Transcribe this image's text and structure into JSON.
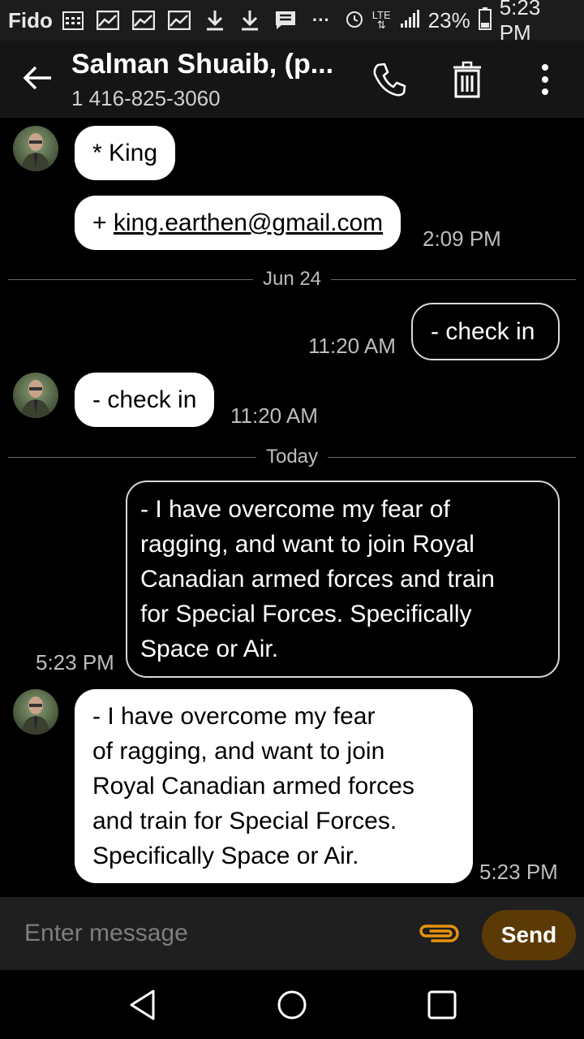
{
  "status_bar": {
    "carrier": "Fido",
    "network": "LTE",
    "battery": "23%",
    "time": "5:23 PM",
    "icons": [
      "calendar-icon",
      "gallery-icon",
      "gallery-icon",
      "gallery-icon",
      "download-icon",
      "download-icon",
      "message-icon",
      "more-icon",
      "alarm-icon",
      "network-icon",
      "signal-icon",
      "battery-icon"
    ]
  },
  "header": {
    "contact_name": "Salman Shuaib, (p...",
    "contact_number": "1 416-825-3060",
    "icons": {
      "back": "back-arrow-icon",
      "call": "phone-icon",
      "delete": "trash-icon",
      "menu": "overflow-menu-icon"
    }
  },
  "conversation": {
    "messages": [
      {
        "direction": "incoming",
        "text": "* King",
        "time": ""
      },
      {
        "direction": "incoming",
        "prefix": "+ ",
        "link": "king.earthen@gmail.com",
        "time": "2:09 PM"
      },
      {
        "direction": "outgoing",
        "text": "- check in",
        "time": "11:20 AM"
      },
      {
        "direction": "incoming",
        "text": "- check in",
        "time": "11:20 AM"
      },
      {
        "direction": "outgoing",
        "lines": [
          "- I have overcome my fear of",
          "ragging, and want to join Royal",
          "Canadian armed forces and train",
          "for Special Forces. Specifically",
          "Space or Air."
        ],
        "time": "5:23 PM"
      },
      {
        "direction": "incoming",
        "lines": [
          "- I have overcome my fear",
          "of ragging, and want to join",
          "Royal Canadian armed forces",
          "and train for Special Forces.",
          "Specifically Space or Air."
        ],
        "time": "5:23 PM"
      }
    ],
    "date_dividers": [
      "Jun 24",
      "Today"
    ]
  },
  "compose": {
    "placeholder": "Enter message",
    "send_label": "Send",
    "attach_icon": "paperclip-icon",
    "accent_color": "#e8930c",
    "send_color": "#5c3a06"
  },
  "nav_bar": {
    "icons": [
      "back-triangle-icon",
      "home-circle-icon",
      "recents-square-icon"
    ]
  }
}
